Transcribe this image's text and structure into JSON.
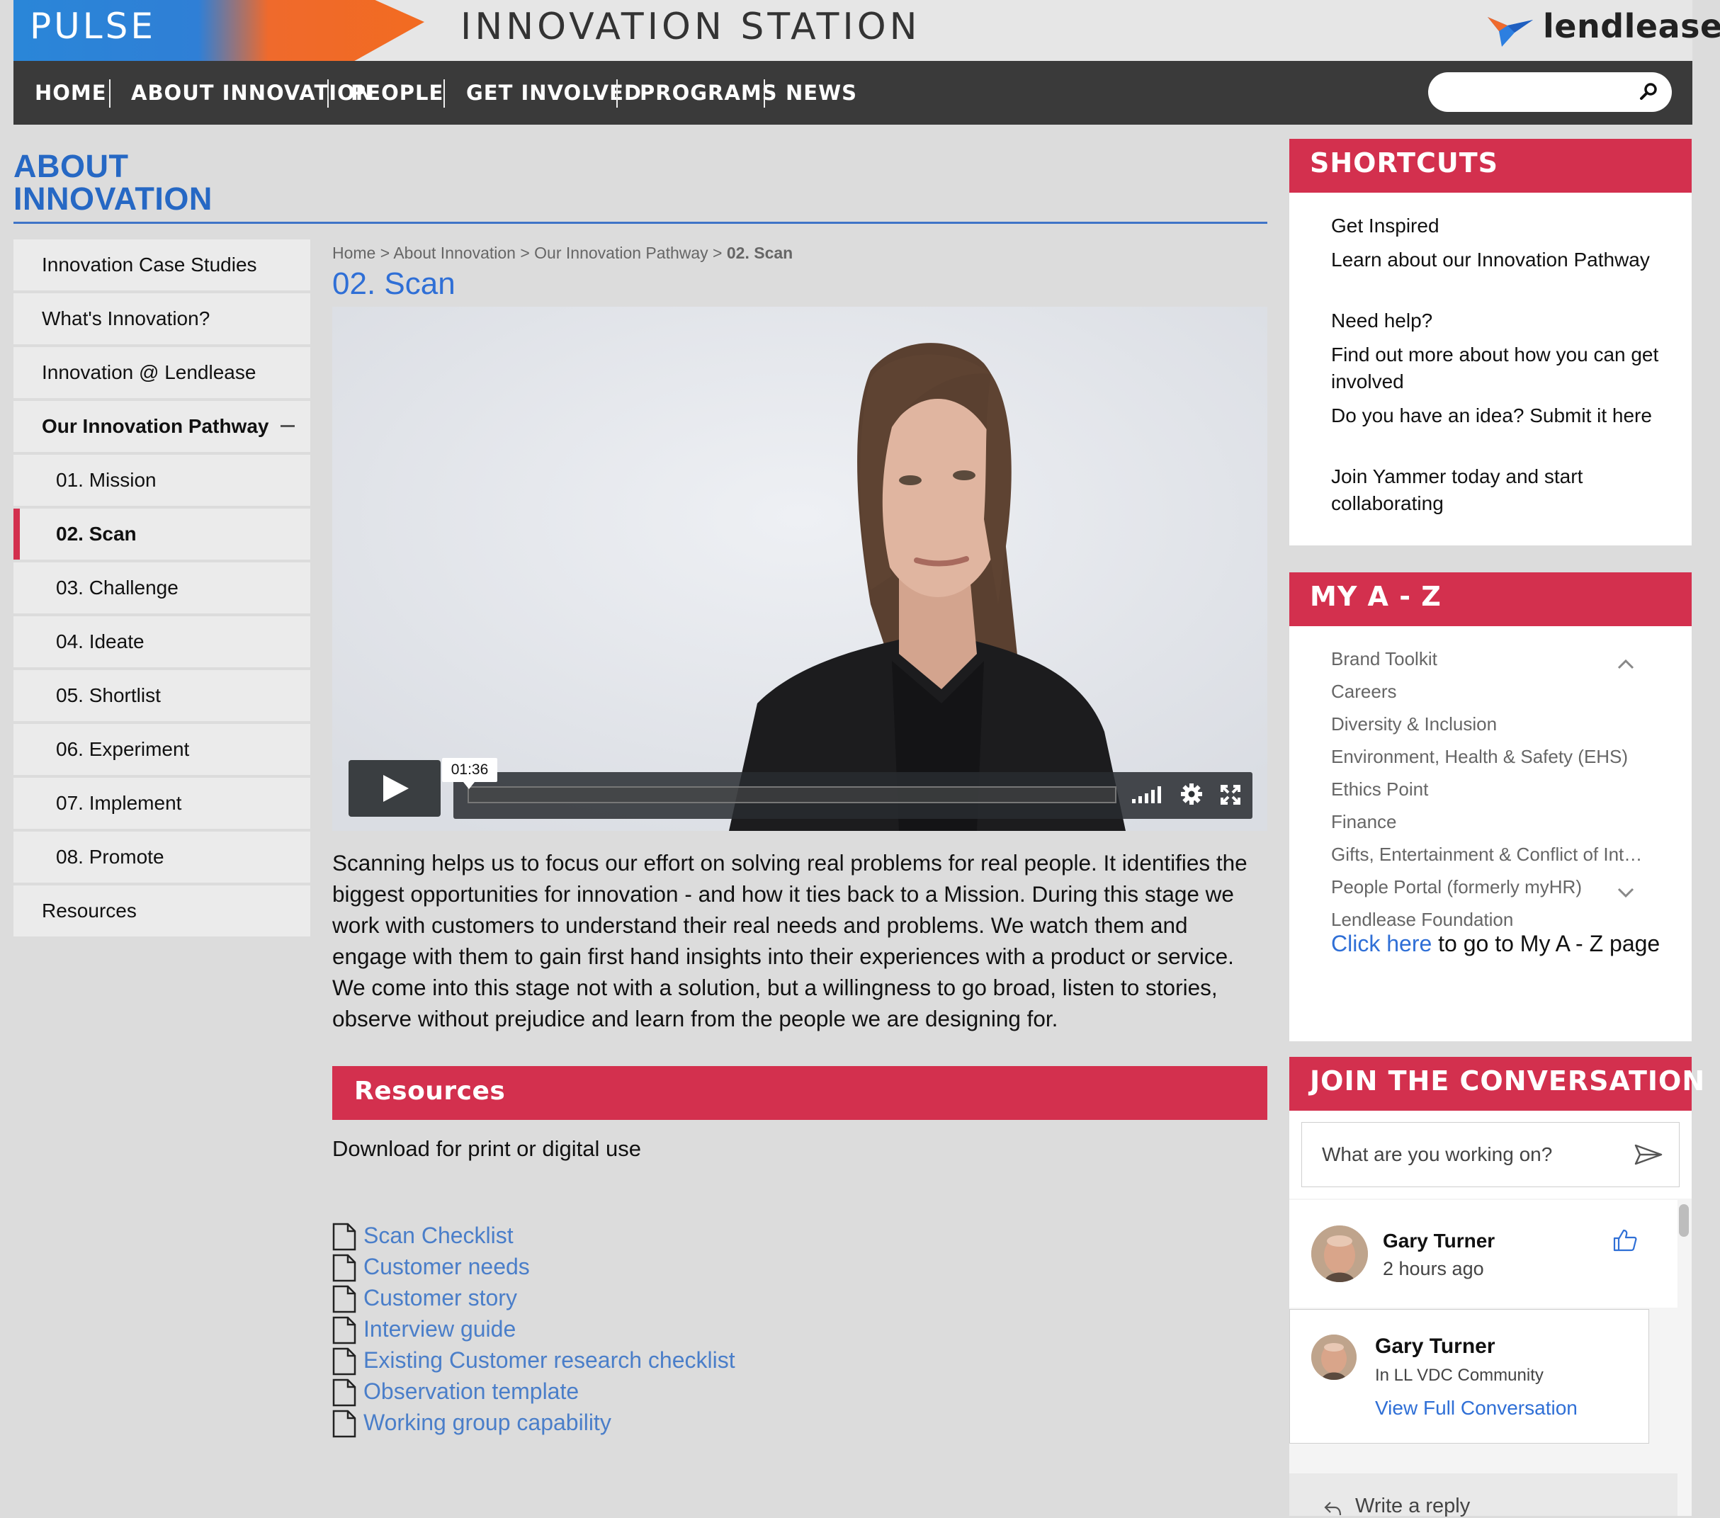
{
  "header": {
    "brand": "PULSE",
    "site_title": "INNOVATION STATION",
    "logo_text": "lendlease",
    "search": {
      "placeholder": ""
    }
  },
  "nav": [
    "HOME",
    "ABOUT INNOVATION",
    "PEOPLE",
    "GET INVOLVED",
    "PROGRAMS",
    "NEWS"
  ],
  "sidebar": {
    "heading_line1": "ABOUT",
    "heading_line2": "INNOVATION",
    "items": [
      {
        "label": "Innovation Case Studies"
      },
      {
        "label": "What's Innovation?"
      },
      {
        "label": "Innovation @ Lendlease"
      },
      {
        "label": "Our Innovation Pathway",
        "expanded": true
      },
      {
        "label": "01. Mission"
      },
      {
        "label": "02. Scan",
        "active": true
      },
      {
        "label": "03. Challenge"
      },
      {
        "label": "04. Ideate"
      },
      {
        "label": "05. Shortlist"
      },
      {
        "label": "06. Experiment"
      },
      {
        "label": "07. Implement"
      },
      {
        "label": "08. Promote"
      },
      {
        "label": "Resources"
      }
    ]
  },
  "main": {
    "breadcrumb": [
      "Home",
      "About Innovation",
      "Our Innovation Pathway",
      "02. Scan"
    ],
    "breadcrumb_sep": " > ",
    "title": "02. Scan",
    "video": {
      "time": "01:36"
    },
    "body": "Scanning helps us to focus our effort on solving real problems for real people. It identifies the biggest opportunities for innovation - and how it ties back to a Mission. During this stage we work with customers to understand their real needs and problems. We watch them and engage with them to gain first hand insights into their experiences with a product or service. We come into this stage not with a solution, but a willingness to go broad, listen to stories, observe without prejudice and learn from the people we are designing for.",
    "resources_title": "Resources",
    "resources_sub": "Download for print or digital use",
    "resources": [
      "Scan Checklist",
      "Customer needs",
      "Customer story",
      "Interview guide",
      "Existing Customer research checklist",
      "Observation template",
      "Working group capability"
    ]
  },
  "shortcuts": {
    "title": "SHORTCUTS",
    "items": [
      "Get Inspired",
      "Learn about our Innovation Pathway",
      "Need help?",
      "Find out more about how you can get involved",
      "Do you have an idea? Submit it here",
      "Join Yammer today and start collaborating"
    ]
  },
  "az": {
    "title": "MY A - Z",
    "items": [
      "Brand Toolkit",
      "Careers",
      "Diversity & Inclusion",
      "Environment, Health & Safety (EHS)",
      "Ethics Point",
      "Finance",
      "Gifts, Entertainment & Conflict of Int…",
      "People Portal (formerly myHR)",
      "Lendlease Foundation"
    ],
    "footer_link": "Click here",
    "footer_text": " to go to My A - Z page"
  },
  "conversation": {
    "title": "JOIN THE CONVERSATION",
    "input_placeholder": "What are you working on?",
    "post": {
      "author": "Gary Turner",
      "time": "2 hours ago"
    },
    "thread": {
      "author": "Gary Turner",
      "group": "In LL VDC Community",
      "link": "View Full Conversation"
    },
    "reply": "Write a reply"
  },
  "colors": {
    "brand_red": "#d3304e",
    "link_blue": "#2f6fd6",
    "nav_bg": "#3a3a3a"
  }
}
